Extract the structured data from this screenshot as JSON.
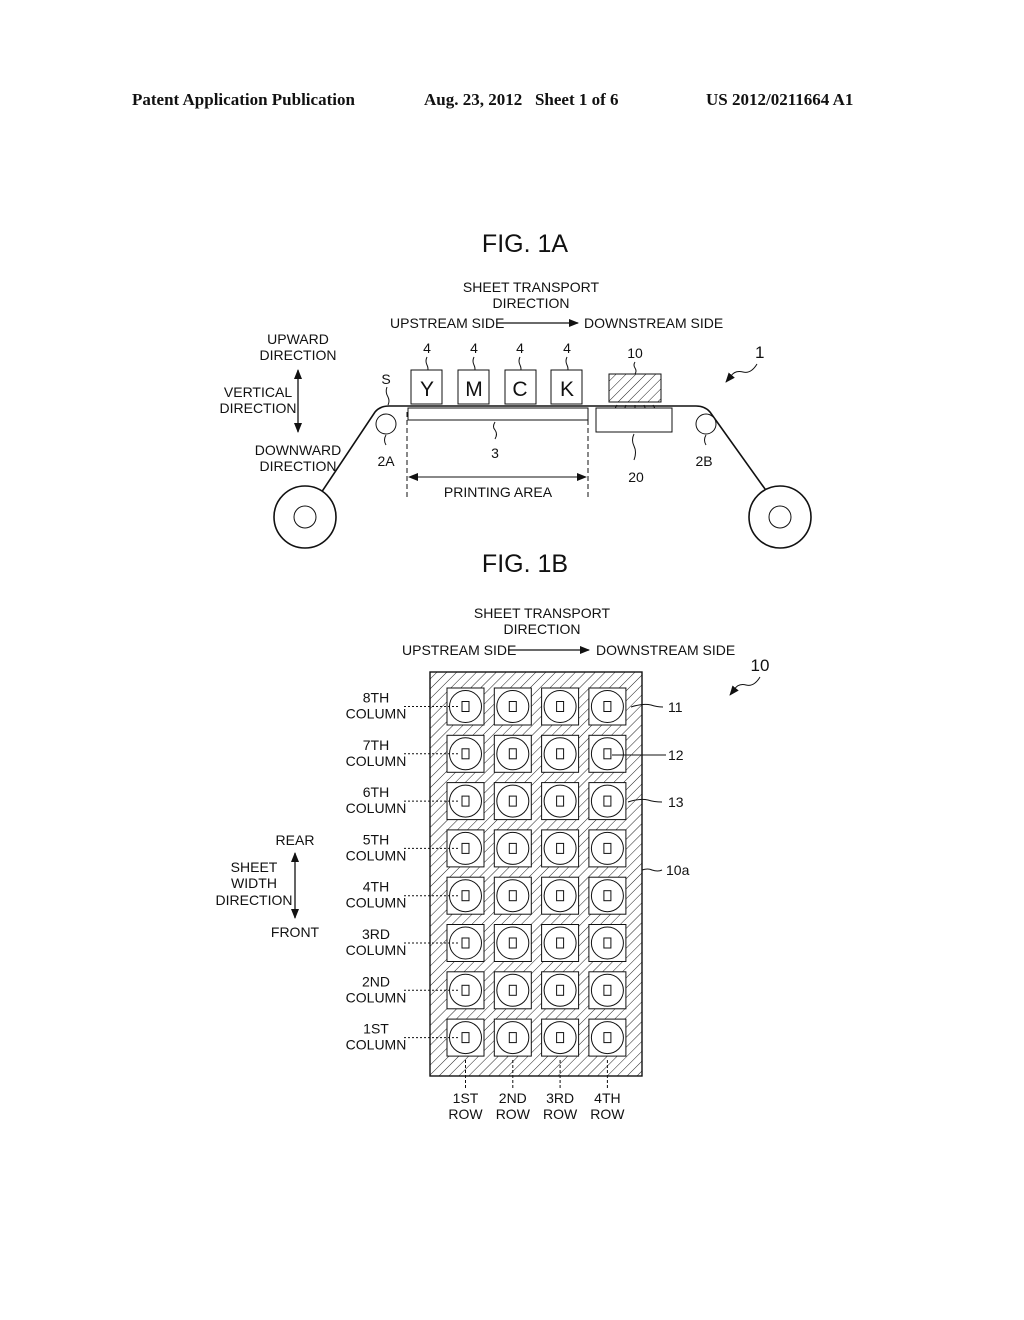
{
  "header": {
    "publication": "Patent Application Publication",
    "date_sheet": "Aug. 23, 2012   Sheet 1 of 6",
    "number": "US 2012/0211664 A1"
  },
  "fig1a": {
    "title": "FIG. 1A",
    "transport_line1": "SHEET TRANSPORT",
    "transport_line2": "DIRECTION",
    "upstream": "UPSTREAM SIDE",
    "downstream": "DOWNSTREAM SIDE",
    "upward_line1": "UPWARD",
    "upward_line2": "DIRECTION",
    "vertical_line1": "VERTICAL",
    "vertical_line2": "DIRECTION",
    "downward_line1": "DOWNWARD",
    "downward_line2": "DIRECTION",
    "heads": [
      {
        "ref": "4",
        "letter": "Y"
      },
      {
        "ref": "4",
        "letter": "M"
      },
      {
        "ref": "4",
        "letter": "C"
      },
      {
        "ref": "4",
        "letter": "K"
      }
    ],
    "ref_light": "10",
    "ref_device": "1",
    "ref_sheet": "S",
    "ref_roller_a": "2A",
    "ref_roller_b": "2B",
    "ref_platen": "3",
    "ref_table": "20",
    "printing_area": "PRINTING AREA"
  },
  "fig1b": {
    "title": "FIG. 1B",
    "transport_line1": "SHEET TRANSPORT",
    "transport_line2": "DIRECTION",
    "upstream": "UPSTREAM SIDE",
    "downstream": "DOWNSTREAM SIDE",
    "ref_unit": "10",
    "ref_11": "11",
    "ref_12": "12",
    "ref_13": "13",
    "ref_10a": "10a",
    "rear": "REAR",
    "sheet_line1": "SHEET",
    "sheet_line2": "WIDTH",
    "sheet_line3": "DIRECTION",
    "front": "FRONT",
    "columns": [
      {
        "ord": "8TH",
        "word": "COLUMN"
      },
      {
        "ord": "7TH",
        "word": "COLUMN"
      },
      {
        "ord": "6TH",
        "word": "COLUMN"
      },
      {
        "ord": "5TH",
        "word": "COLUMN"
      },
      {
        "ord": "4TH",
        "word": "COLUMN"
      },
      {
        "ord": "3RD",
        "word": "COLUMN"
      },
      {
        "ord": "2ND",
        "word": "COLUMN"
      },
      {
        "ord": "1ST",
        "word": "COLUMN"
      }
    ],
    "rows": [
      {
        "ord": "1ST",
        "word": "ROW"
      },
      {
        "ord": "2ND",
        "word": "ROW"
      },
      {
        "ord": "3RD",
        "word": "ROW"
      },
      {
        "ord": "4TH",
        "word": "ROW"
      }
    ]
  }
}
